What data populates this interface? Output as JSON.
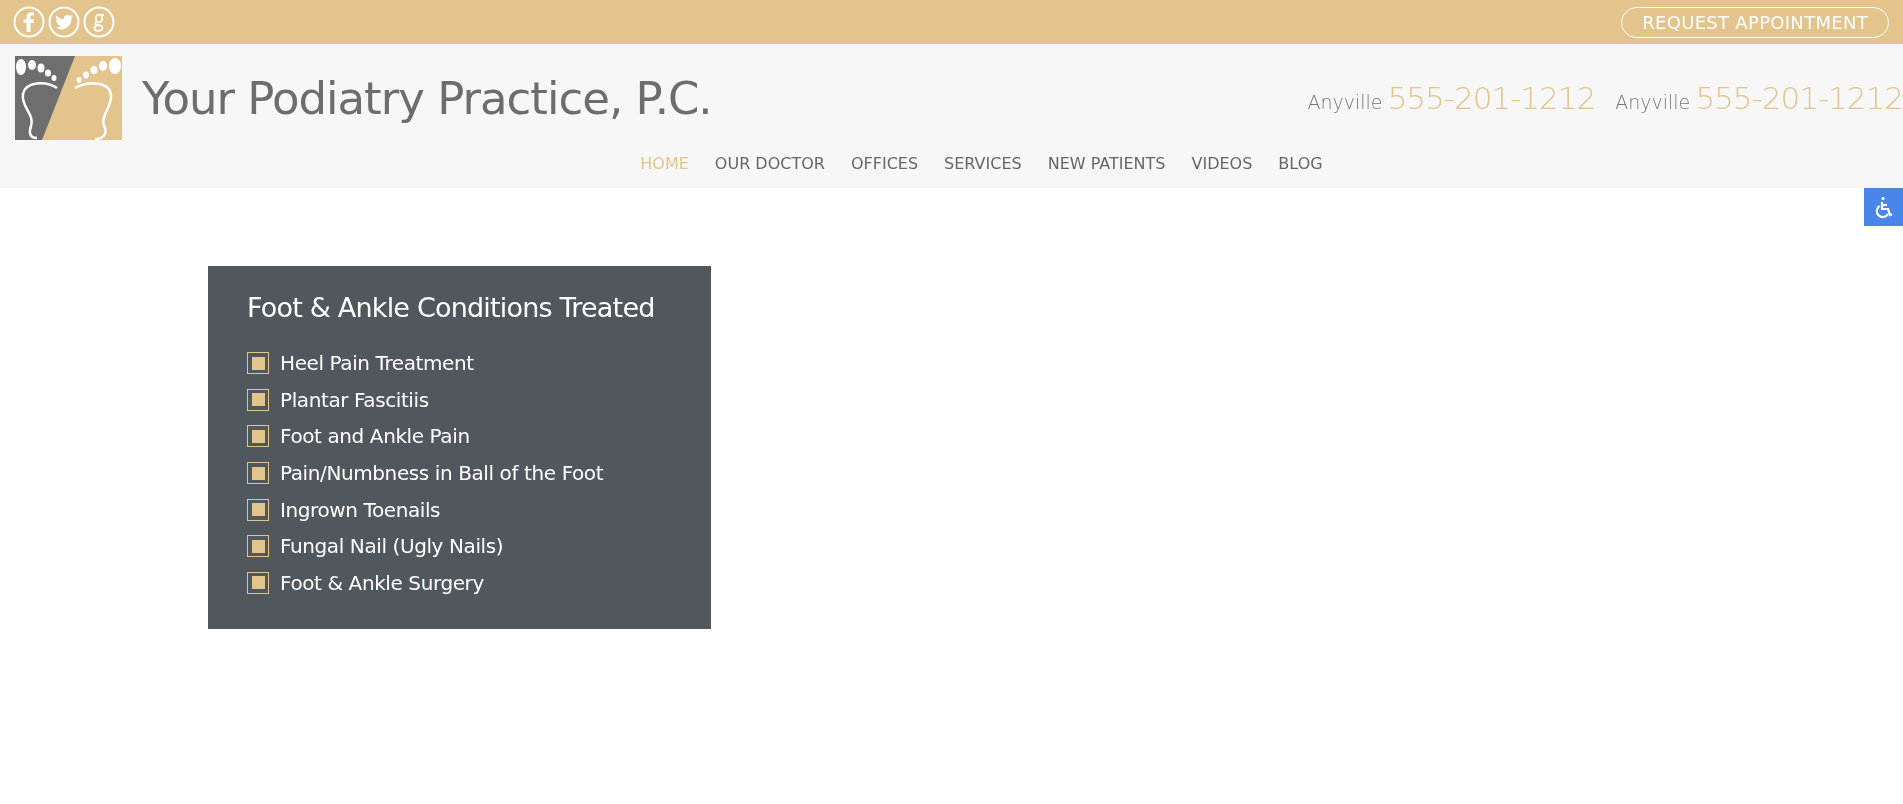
{
  "top_bar": {
    "button": "REQUEST APPOINTMENT"
  },
  "header": {
    "title": "Your Podiatry Practice, P.C.",
    "phones": [
      {
        "city": "Anyville",
        "number": "555-201-1212"
      },
      {
        "city": "Anyville",
        "number": "555-201-1212"
      }
    ]
  },
  "nav": [
    {
      "label": "HOME",
      "selected": true
    },
    {
      "label": "OUR DOCTOR",
      "selected": false
    },
    {
      "label": "OFFICES",
      "selected": false
    },
    {
      "label": "SERVICES",
      "selected": false
    },
    {
      "label": "NEW PATIENTS",
      "selected": false
    },
    {
      "label": "VIDEOS",
      "selected": false
    },
    {
      "label": "BLOG",
      "selected": false
    }
  ],
  "conditions": {
    "title": "Foot & Ankle Conditions Treated",
    "items": [
      "Heel Pain Treatment",
      "Plantar Fascitiis",
      "Foot and Ankle Pain",
      "Pain/Numbness in Ball of the Foot",
      "Ingrown Toenails",
      "Fungal Nail (Ugly Nails)",
      "Foot & Ankle Surgery"
    ]
  }
}
